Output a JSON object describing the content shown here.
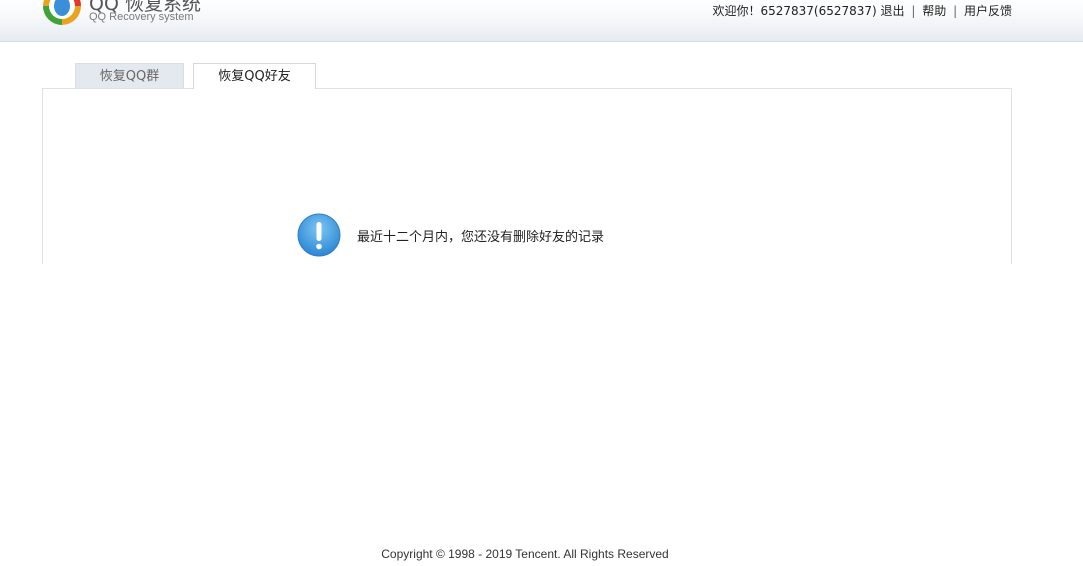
{
  "header": {
    "brand_title": "QQ 恢复系统",
    "brand_subtitle": "QQ Recovery system",
    "welcome": "欢迎你！6527837(6527837)",
    "logout": "退出",
    "help": "帮助",
    "feedback": "用户反馈",
    "separator": "|"
  },
  "tabs": {
    "group": "恢复QQ群",
    "friend": "恢复QQ好友"
  },
  "main": {
    "message": "最近十二个月内，您还没有删除好友的记录",
    "icon": "info-icon"
  },
  "footer": {
    "copyright": "Copyright © 1998 - 2019 Tencent. All Rights Reserved"
  },
  "colors": {
    "header_bg": "#eef2f6",
    "tab_inactive_bg": "#e4e9ef",
    "info_icon_blue": "#3a97dc"
  }
}
